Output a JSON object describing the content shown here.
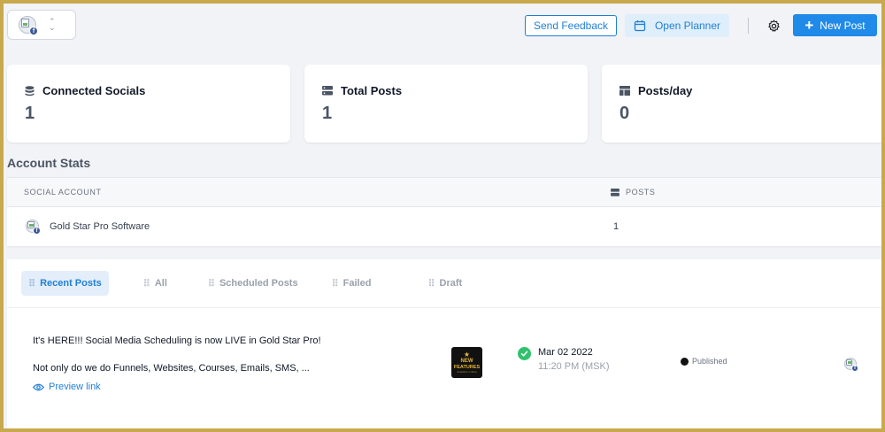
{
  "colors": {
    "accent": "#1f8ae8",
    "frame": "#c9a94e",
    "success": "#2fc26c",
    "page_background": "#f1f3f6"
  },
  "header": {
    "account_switcher": {
      "avatar_icon": "broken-image-icon",
      "badge_icon": "facebook-badge-icon",
      "badge": "f"
    },
    "send_feedback_label": "Send Feedback",
    "open_planner_label": "Open Planner",
    "new_post_label": "New Post"
  },
  "stats_cards": [
    {
      "title": "Connected Socials",
      "value": "1",
      "icon": "database-icon"
    },
    {
      "title": "Total Posts",
      "value": "1",
      "icon": "server-icon"
    },
    {
      "title": "Posts/day",
      "value": "0",
      "icon": "layout-icon"
    }
  ],
  "account_stats": {
    "title": "Account Stats",
    "columns": [
      "SOCIAL ACCOUNT",
      "POSTS"
    ],
    "rows": [
      {
        "account": "Gold Star Pro Software",
        "posts": "1"
      }
    ]
  },
  "posts": {
    "tabs": [
      {
        "label": "Recent Posts",
        "active": true
      },
      {
        "label": "All",
        "active": false
      },
      {
        "label": "Scheduled Posts",
        "active": false
      },
      {
        "label": "Failed",
        "active": false
      },
      {
        "label": "Draft",
        "active": false
      }
    ],
    "items": [
      {
        "line1": "It's HERE!!! Social Media Scheduling is now LIVE in Gold Star Pro!",
        "line2": "Not only do we do Funnels, Websites, Courses, Emails, SMS, ...",
        "preview_label": "Preview link",
        "thumbnail": {
          "line1": "NEW",
          "line2": "FEATURES",
          "line3": "Available in Beta"
        },
        "date": "Mar 02 2022",
        "time": "11:20 PM (MSK)",
        "status": "Published"
      }
    ]
  }
}
